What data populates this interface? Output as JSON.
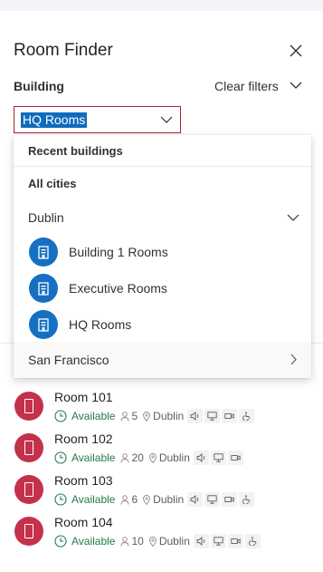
{
  "header": {
    "title": "Room Finder",
    "close_icon": "close-icon"
  },
  "filters": {
    "building_label": "Building",
    "clear_filters_label": "Clear filters",
    "selected_building": "HQ Rooms"
  },
  "dropdown": {
    "recent_label": "Recent buildings",
    "all_cities_label": "All cities",
    "expanded_city": "Dublin",
    "buildings": [
      {
        "label": "Building 1 Rooms",
        "icon": "building-icon"
      },
      {
        "label": "Executive Rooms",
        "icon": "building-icon"
      },
      {
        "label": "HQ Rooms",
        "icon": "building-icon"
      }
    ],
    "collapsed_city": "San Francisco"
  },
  "rooms": [
    {
      "name": "Room 101",
      "status": "Available",
      "capacity": "5",
      "city": "Dublin",
      "amenities": [
        "audio-icon",
        "display-icon",
        "video-icon",
        "accessible-icon"
      ]
    },
    {
      "name": "Room 102",
      "status": "Available",
      "capacity": "20",
      "city": "Dublin",
      "amenities": [
        "audio-icon",
        "display-icon",
        "video-icon"
      ]
    },
    {
      "name": "Room 103",
      "status": "Available",
      "capacity": "6",
      "city": "Dublin",
      "amenities": [
        "audio-icon",
        "display-icon",
        "video-icon",
        "accessible-icon"
      ]
    },
    {
      "name": "Room 104",
      "status": "Available",
      "capacity": "10",
      "city": "Dublin",
      "amenities": [
        "audio-icon",
        "display-icon",
        "video-icon",
        "accessible-icon"
      ]
    }
  ],
  "colors": {
    "accent": "#0f6cbd",
    "building_icon_bg": "#1570c2",
    "room_avatar_bg": "#c4314b",
    "available_green": "#237b4b",
    "error_border": "#a4262c"
  }
}
